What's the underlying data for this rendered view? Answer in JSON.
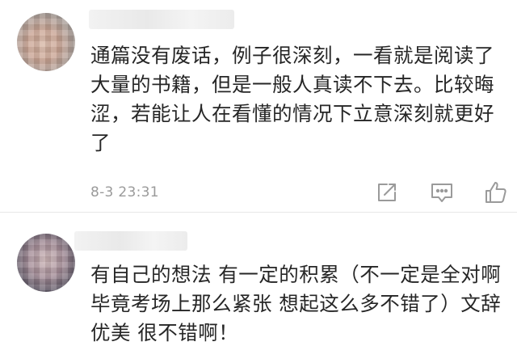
{
  "comments": [
    {
      "text": "通篇没有废话，例子很深刻，一看就是阅读了大量的书籍，但是一般人真读不下去。比较晦涩，若能让人在看懂的情况下立意深刻就更好了",
      "timestamp": "8-3 23:31",
      "actions": {
        "share_icon": "share-icon",
        "reply_icon": "comment-icon",
        "like_icon": "thumbs-up-icon"
      }
    },
    {
      "text": "有自己的想法 有一定的积累（不一定是全对啊 毕竟考场上那么紧张 想起这么多不错了）文辞优美 很不错啊！"
    }
  ],
  "colors": {
    "text": "#262626",
    "meta": "#9a9a9a",
    "icon": "#9a9a9a",
    "divider": "#e8e8e8"
  }
}
